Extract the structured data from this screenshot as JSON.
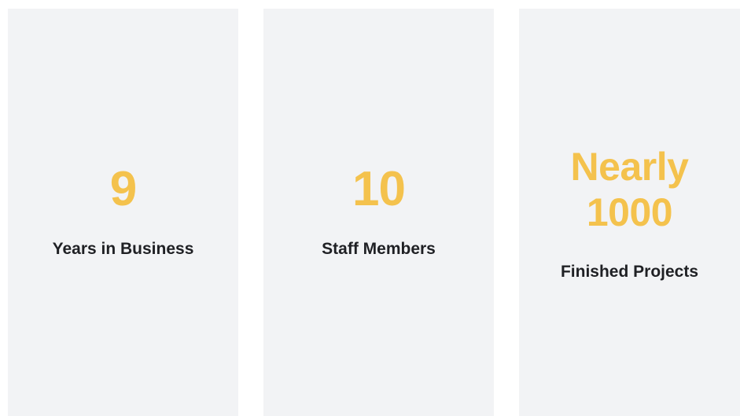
{
  "stats": [
    {
      "value": "9",
      "label": "Years in Business"
    },
    {
      "value": "10",
      "label": "Staff Members"
    },
    {
      "value_line1": "Nearly",
      "value_line2": "1000",
      "label": "Finished Projects"
    }
  ],
  "colors": {
    "card_background": "#f2f3f5",
    "value_accent": "#f4c24d",
    "label_text": "#1f2024"
  }
}
